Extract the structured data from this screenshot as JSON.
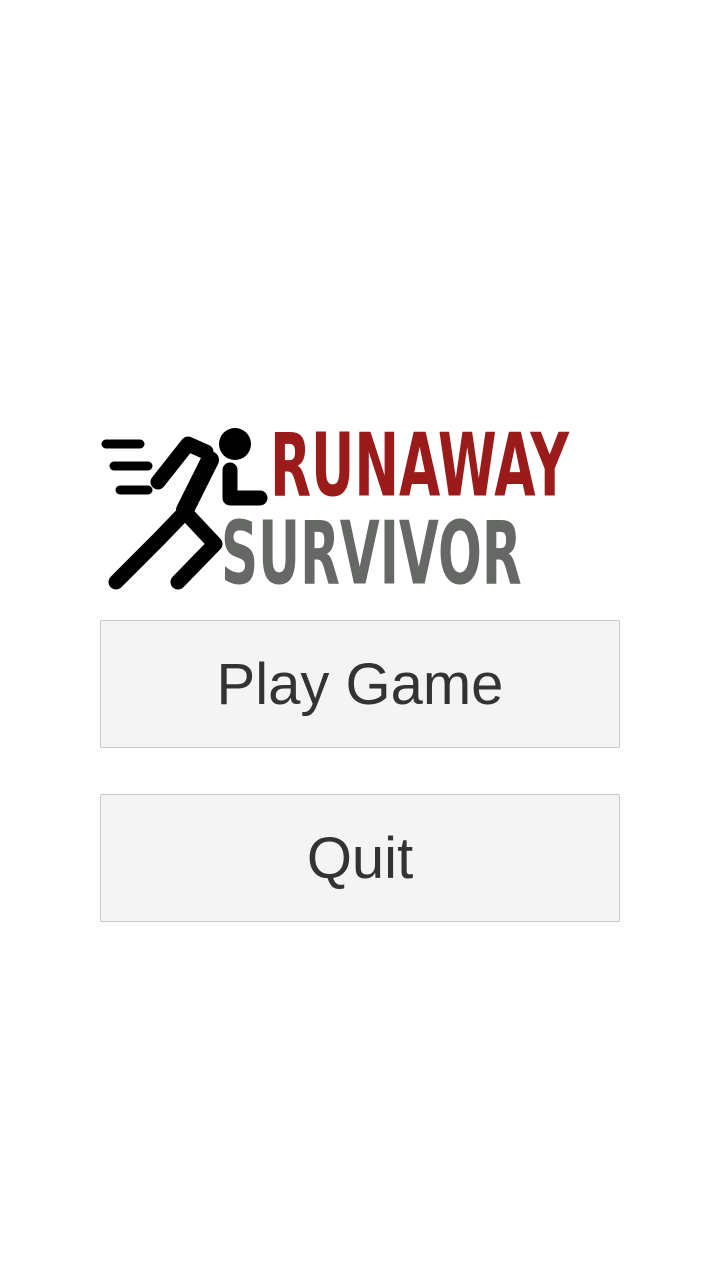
{
  "logo": {
    "line1": "RUNAWAY",
    "line2": "SURVIVOR",
    "line1_color": "#9b1b1b",
    "line2_color": "#666866",
    "runner_color": "#000000",
    "icon": "running-man-icon"
  },
  "menu": {
    "play_label": "Play Game",
    "quit_label": "Quit",
    "text_color": "#333333"
  }
}
